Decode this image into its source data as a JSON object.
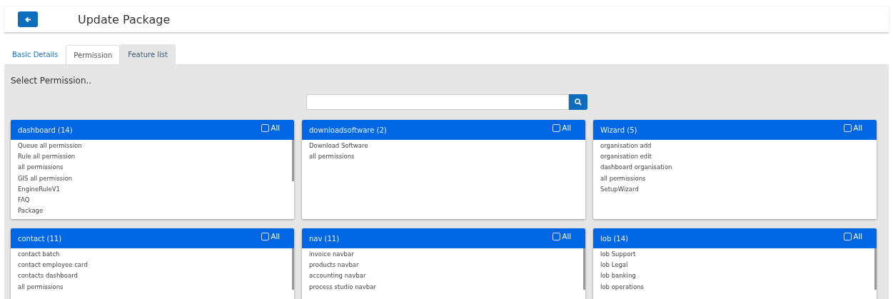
{
  "header": {
    "title": "Update Package"
  },
  "tabs": [
    {
      "label": "Basic Details",
      "selected": false
    },
    {
      "label": "Permission",
      "selected": true
    },
    {
      "label": "Feature list",
      "selected": false
    }
  ],
  "section_title": "Select Permission..",
  "groups": [
    {
      "title": "dashboard (14)",
      "all_label": "All",
      "all_checked": false,
      "scrollable": true,
      "items": [
        "Queue all permission",
        "Rule all permission",
        "all permissions",
        "GIS all permission",
        "EngineRuleV1",
        "FAQ",
        "Package"
      ]
    },
    {
      "title": "downloadsoftware (2)",
      "all_label": "All",
      "all_checked": false,
      "scrollable": false,
      "items": [
        "Download Software",
        "all permissions"
      ]
    },
    {
      "title": "Wizard (5)",
      "all_label": "All",
      "all_checked": false,
      "scrollable": false,
      "items": [
        "organisation add",
        "organisation edit",
        "dashboard organisation",
        "all permissions",
        "SetupWizard"
      ]
    },
    {
      "title": "contact (11)",
      "all_label": "All",
      "all_checked": false,
      "scrollable": true,
      "items": [
        "contact batch",
        "contact employee card",
        "contacts dashboard",
        "all permissions"
      ]
    },
    {
      "title": "nav (11)",
      "all_label": "All",
      "all_checked": false,
      "scrollable": true,
      "items": [
        "invoice navbar",
        "products navbar",
        "accounting navbar",
        "process studio navbar"
      ]
    },
    {
      "title": "lob (14)",
      "all_label": "All",
      "all_checked": false,
      "scrollable": true,
      "items": [
        "lob Support",
        "lob Legal",
        "lob banking",
        "lob operations"
      ]
    }
  ]
}
